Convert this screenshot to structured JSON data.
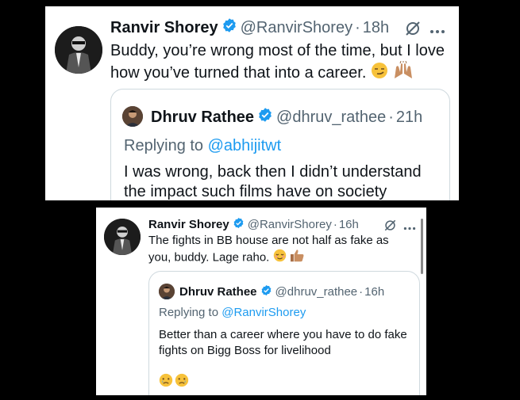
{
  "tweets": [
    {
      "author_name": "Ranvir Shorey",
      "handle": "@RanvirShorey",
      "time": "18h",
      "text": "Buddy, you’re wrong most of the time, but I love how you’ve turned that into a career.",
      "emojis": [
        "smirk-emoji",
        "raised-hands-emoji"
      ],
      "quoted": {
        "author_name": "Dhruv Rathee",
        "handle": "@dhruv_rathee",
        "time": "21h",
        "replying_label": "Replying to",
        "replying_handle": "@abhijitwt",
        "text": "I was wrong, back then I didn’t understand the impact such films have on society"
      }
    },
    {
      "author_name": "Ranvir Shorey",
      "handle": "@RanvirShorey",
      "time": "16h",
      "text": "The fights in BB house are not half as fake as you, buddy. Lage raho.",
      "emojis": [
        "relieved-emoji",
        "thumbs-up-emoji"
      ],
      "quoted": {
        "author_name": "Dhruv Rathee",
        "handle": "@dhruv_rathee",
        "time": "16h",
        "replying_label": "Replying to",
        "replying_handle": "@RanvirShorey",
        "text": "Better than a career where you have to do fake fights on Bigg Boss for livelihood",
        "emojis": [
          "crying-emoji",
          "crying-emoji"
        ]
      }
    }
  ],
  "separator": "·",
  "colors": {
    "link": "#1d9bf0",
    "muted": "#536471",
    "verified": "#1d9bf0",
    "border": "#cfd9de"
  }
}
